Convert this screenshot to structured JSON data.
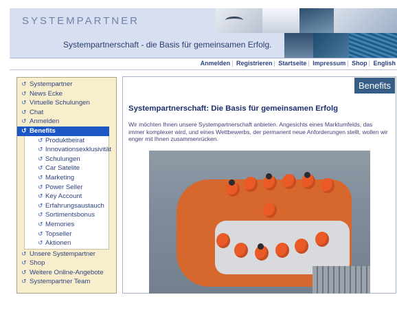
{
  "header": {
    "brand": "SYSTEMPARTNER",
    "tagline": "Systempartnerschaft - die Basis für gemeinsamen Erfolg."
  },
  "topnav": {
    "items": [
      "Anmelden",
      "Registrieren",
      "Startseite",
      "Impressum",
      "Shop",
      "English"
    ]
  },
  "sidebar": {
    "items": [
      "Systempartner",
      "News Ecke",
      "Virtuelle Schulungen",
      "Chat",
      "Anmelden",
      "Benefits"
    ],
    "active": "Benefits",
    "subitems": [
      "Produktbeirat",
      "Innovationsexklusivität",
      "Schulungen",
      "Car Satelite",
      "Marketing",
      "Power Seller",
      "Key Account",
      "Erfahrungsaustauch",
      "Sortimentsbonus",
      "Memories",
      "Topseller",
      "Aktionen"
    ],
    "more_items": [
      "Unsere Systempartner",
      "Shop",
      "Weitere Online-Angebote",
      "Systempartner Team"
    ]
  },
  "main": {
    "badge": "Benefits",
    "title": "Systempartnerschaft: Die Basis für gemeinsamen Erfolg",
    "intro": "Wir möchten Ihnen unsere Systempartnerschaft anbieten. Angesichts eines Marktumfelds, das immer komplexer wird, und eines Wettbewerbs, der permanent neue Anforderungen stellt, wollen wir enger mit Ihnen zusammenrücken."
  },
  "colors": {
    "header_bg": "#d7dff0",
    "sidebar_bg": "#f8eecb",
    "active_bg": "#1c57c6",
    "badge_bg": "#355d86",
    "link": "#2e4281"
  }
}
